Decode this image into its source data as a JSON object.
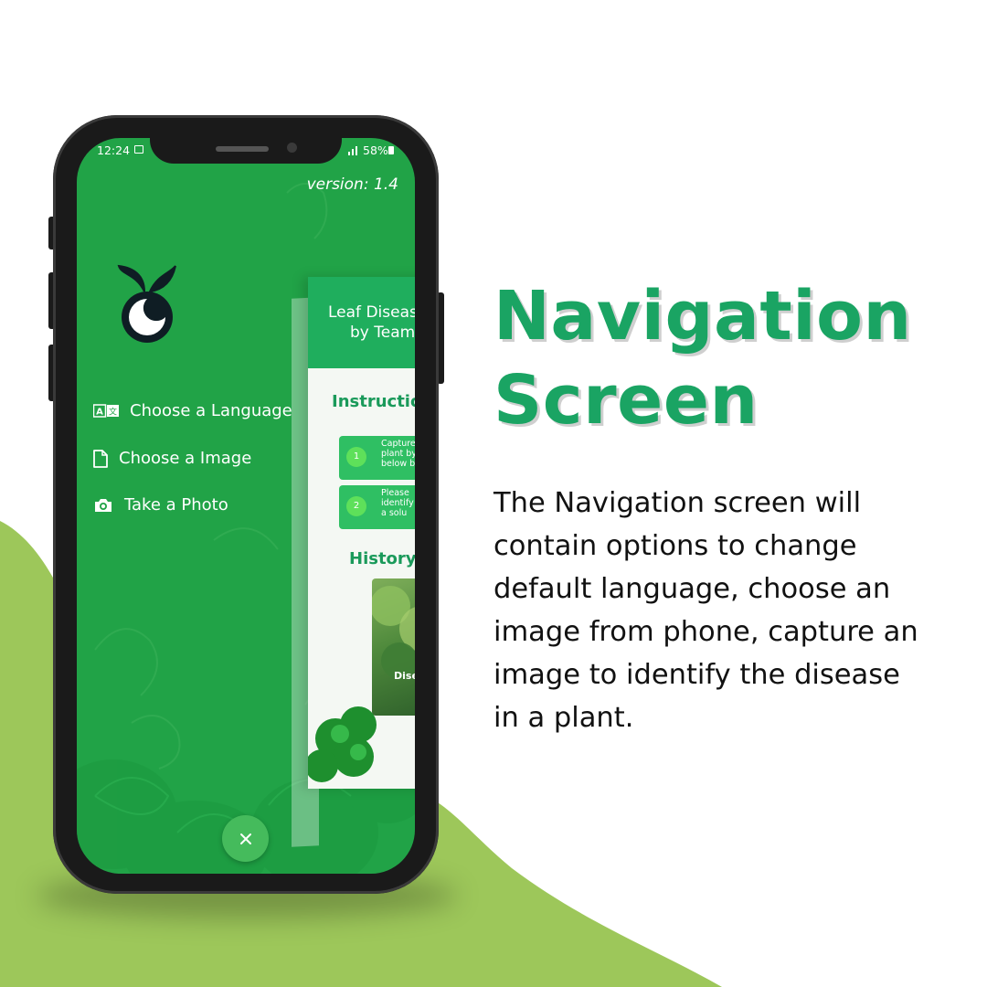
{
  "headline": {
    "line1": "Navigation",
    "line2": "Screen"
  },
  "description": "The Navigation screen will contain options to change default language, choose an image from phone, capture an image to identify the disease in a plant.",
  "status_bar": {
    "time": "12:24",
    "battery": "58%"
  },
  "drawer": {
    "version": "version: 1.4",
    "items": [
      {
        "label": "Choose a Language",
        "icon": "translate-icon"
      },
      {
        "label": "Choose a Image",
        "icon": "file-icon"
      },
      {
        "label": "Take a Photo",
        "icon": "camera-icon"
      }
    ],
    "close_icon": "close-icon"
  },
  "background_screen": {
    "header_line1": "Leaf Diseas",
    "header_line2": "by Team",
    "instructions_heading": "Instruction",
    "steps": [
      {
        "number": "1",
        "text": "Capture\nplant by\nbelow b"
      },
      {
        "number": "2",
        "text": "Please\nidentify\na solu"
      }
    ],
    "history_heading": "History",
    "history_item_label": "Dise"
  },
  "colors": {
    "brand_green": "#1aa463",
    "screen_green": "#21a347",
    "blob_green": "#9dc75a"
  }
}
